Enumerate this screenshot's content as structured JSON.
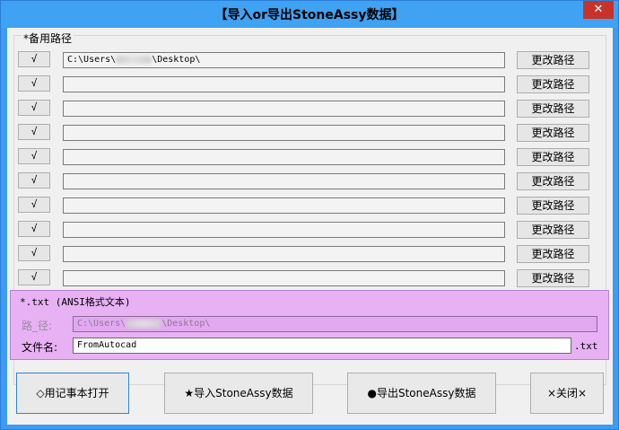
{
  "window": {
    "title": "【导入or导出StoneAssy数据】",
    "close_glyph": "✕"
  },
  "backup_paths": {
    "label": "*备用路径",
    "rows": [
      {
        "check": "√",
        "path": "C:\\Users\\",
        "path_suffix": "\\Desktop\\",
        "button": "更改路径"
      },
      {
        "check": "√",
        "path": "",
        "path_suffix": "",
        "button": "更改路径"
      },
      {
        "check": "√",
        "path": "",
        "path_suffix": "",
        "button": "更改路径"
      },
      {
        "check": "√",
        "path": "",
        "path_suffix": "",
        "button": "更改路径"
      },
      {
        "check": "√",
        "path": "",
        "path_suffix": "",
        "button": "更改路径"
      },
      {
        "check": "√",
        "path": "",
        "path_suffix": "",
        "button": "更改路径"
      },
      {
        "check": "√",
        "path": "",
        "path_suffix": "",
        "button": "更改路径"
      },
      {
        "check": "√",
        "path": "",
        "path_suffix": "",
        "button": "更改路径"
      },
      {
        "check": "√",
        "path": "",
        "path_suffix": "",
        "button": "更改路径"
      },
      {
        "check": "√",
        "path": "",
        "path_suffix": "",
        "button": "更改路径"
      }
    ]
  },
  "txt_section": {
    "title": "*.txt (ANSI格式文本)",
    "path_label": "路_径:",
    "path_value": "C:\\Users\\",
    "path_suffix": "\\Desktop\\",
    "filename_label": "文件名:",
    "filename_value": "FromAutocad",
    "extension": ".txt"
  },
  "buttons": {
    "open_notepad": "◇用记事本打开",
    "import": "★导入StoneAssy数据",
    "export": "●导出StoneAssy数据",
    "close": "×关闭×"
  },
  "colors": {
    "titlebar": "#3fa2f3",
    "close": "#c7332b",
    "txt_panel": "#e7b1f4"
  }
}
